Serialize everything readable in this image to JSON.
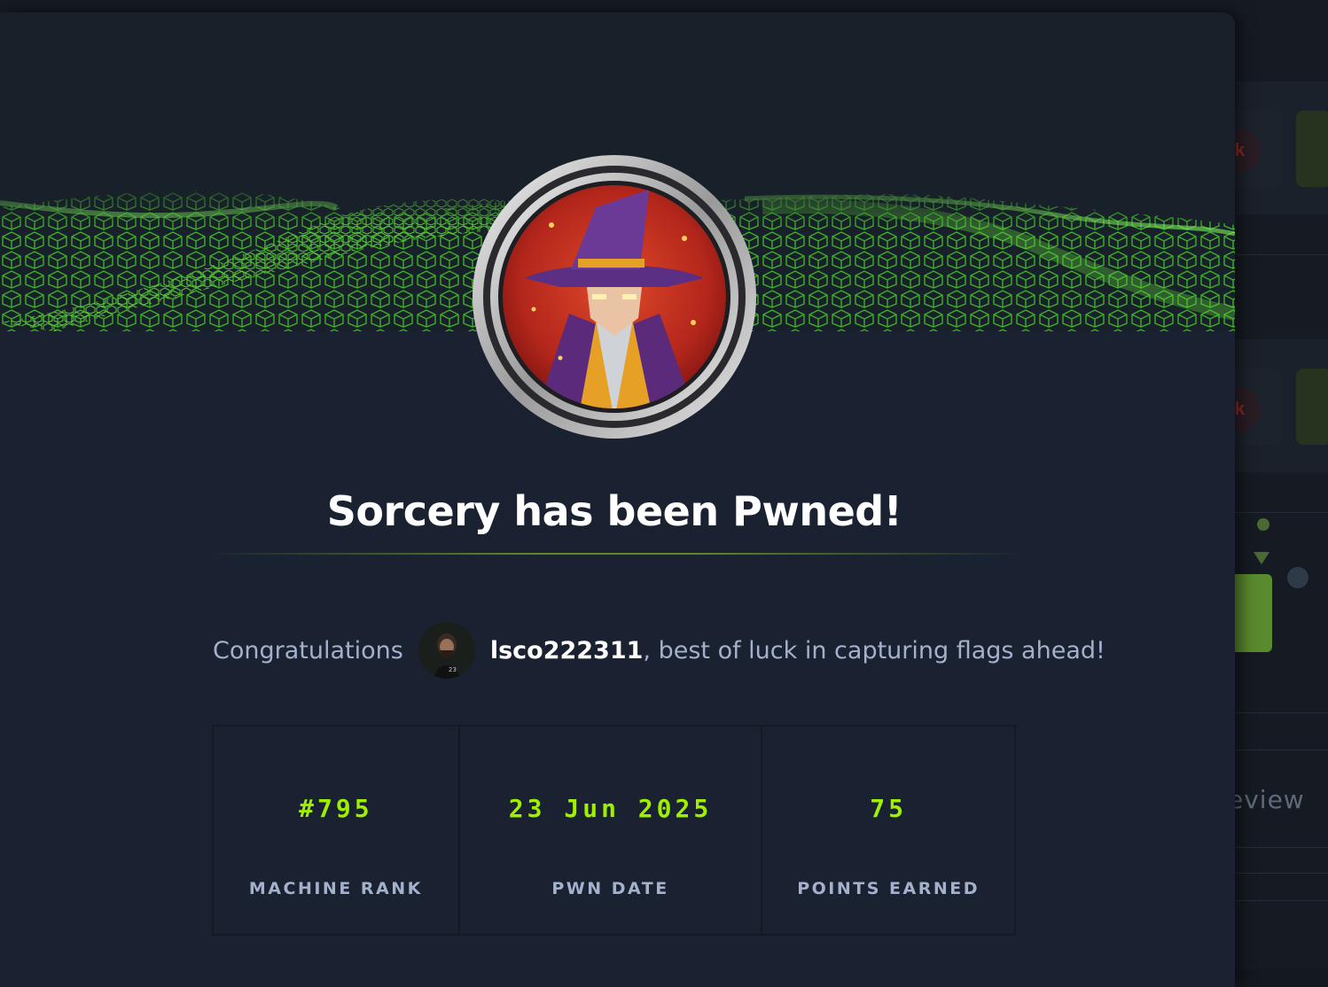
{
  "modal": {
    "title": "Sorcery has been Pwned!",
    "congrats_prefix": "Congratulations",
    "username": "lsco222311",
    "congrats_suffix": ", best of luck in capturing flags ahead!",
    "stats": [
      {
        "value": "#795",
        "label": "MACHINE RANK"
      },
      {
        "value": "23 Jun 2025",
        "label": "PWN DATE"
      },
      {
        "value": "75",
        "label": "POINTS EARNED"
      }
    ]
  },
  "background": {
    "review_fragment": "eview",
    "badge_letter": "k"
  },
  "colors": {
    "accent": "#9fef00",
    "modal_bg": "#1a2130",
    "muted_text": "#a4b1cd"
  }
}
